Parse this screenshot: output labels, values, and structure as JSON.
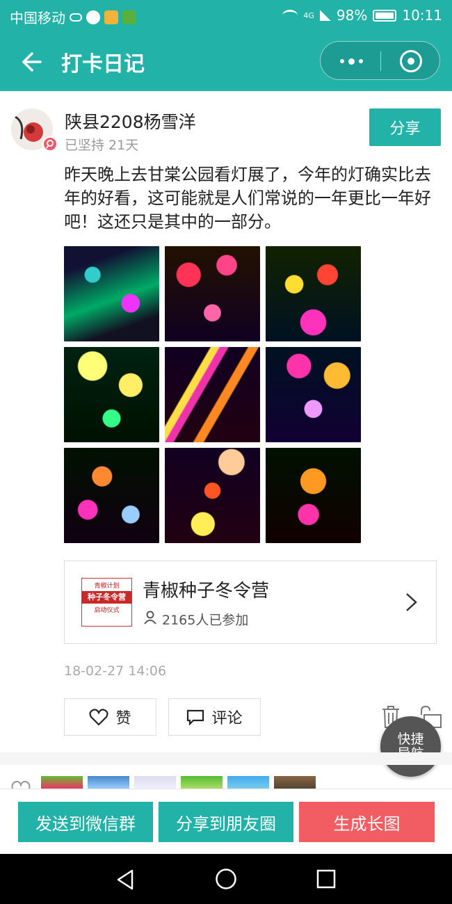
{
  "status_bar": {
    "carrier": "中国移动",
    "network": "4G",
    "battery": "98%",
    "time": "10:11"
  },
  "header": {
    "title": "打卡日记"
  },
  "post": {
    "username": "陕县2208杨雪洋",
    "persist": "已坚持 21天",
    "share_label": "分享",
    "text": "昨天晚上去甘棠公园看灯展了，今年的灯确实比去年的好看，这可能就是人们常说的一年更比一年好吧！这还只是其中的一部分。",
    "photos": [
      "lantern-photo-1",
      "lantern-photo-2",
      "lantern-photo-3",
      "lantern-photo-4",
      "lantern-photo-5",
      "lantern-photo-6",
      "lantern-photo-7",
      "lantern-photo-8",
      "lantern-photo-9"
    ],
    "timestamp": "18-02-27 14:06"
  },
  "camp_card": {
    "title": "青椒种子冬令营",
    "participants": "2165人已参加",
    "thumb_top": "青椒计划",
    "thumb_mid": "种子冬令营",
    "thumb_bottom": "启动仪式"
  },
  "actions": {
    "like_label": "赞",
    "comment_label": "评论"
  },
  "fab": {
    "line1": "快捷",
    "line2": "导航"
  },
  "bottom_bar": {
    "send_group": "发送到微信群",
    "share_moments": "分享到朋友圈",
    "long_image": "生成长图"
  },
  "colors": {
    "brand": "#22b2a8",
    "red_button": "#f25c63",
    "fab": "#555555"
  }
}
